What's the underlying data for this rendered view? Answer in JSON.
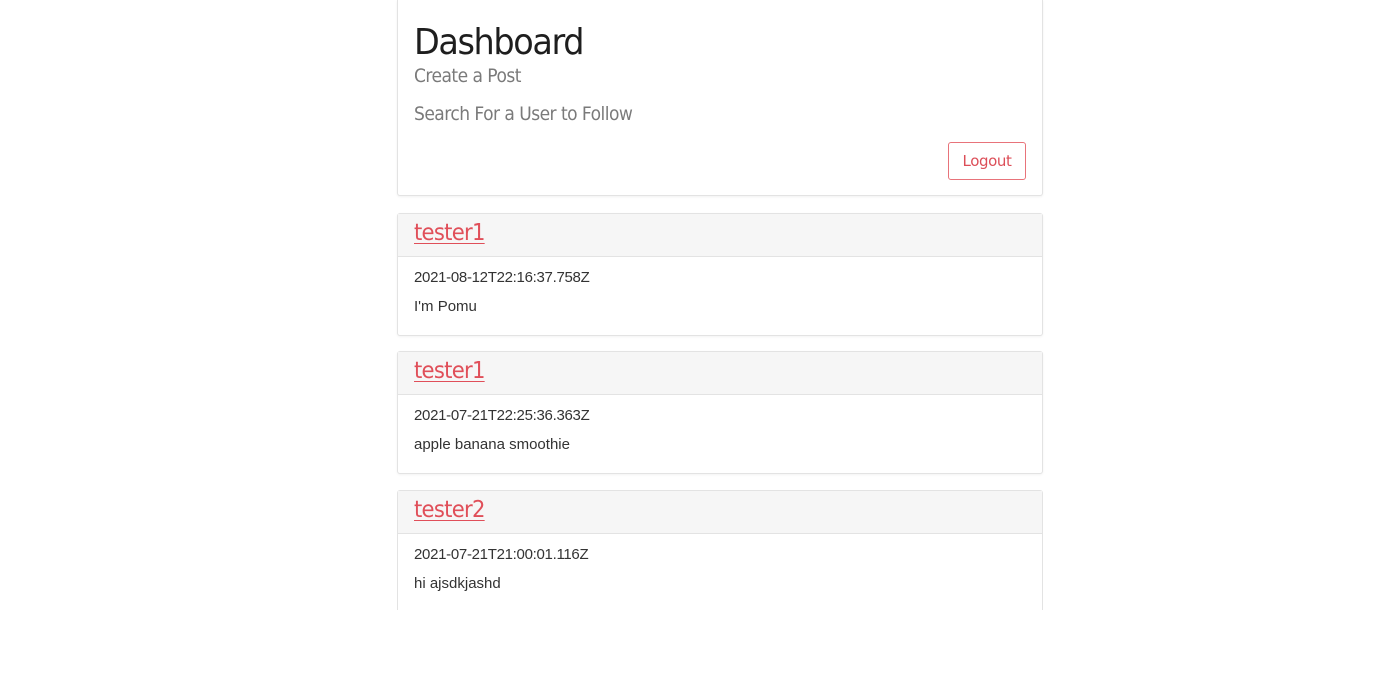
{
  "header": {
    "title": "Dashboard",
    "create_post_label": "Create a Post",
    "search_user_label": "Search For a User to Follow",
    "logout_label": "Logout"
  },
  "posts": [
    {
      "author": "tester1",
      "timestamp": "2021-08-12T22:16:37.758Z",
      "content": "I'm Pomu"
    },
    {
      "author": "tester1",
      "timestamp": "2021-07-21T22:25:36.363Z",
      "content": "apple banana smoothie"
    },
    {
      "author": "tester2",
      "timestamp": "2021-07-21T21:00:01.116Z",
      "content": "hi ajsdkjashd"
    }
  ],
  "colors": {
    "accent": "#e04f59",
    "header_bg": "#f6f6f6",
    "border": "#e3e3e3"
  }
}
